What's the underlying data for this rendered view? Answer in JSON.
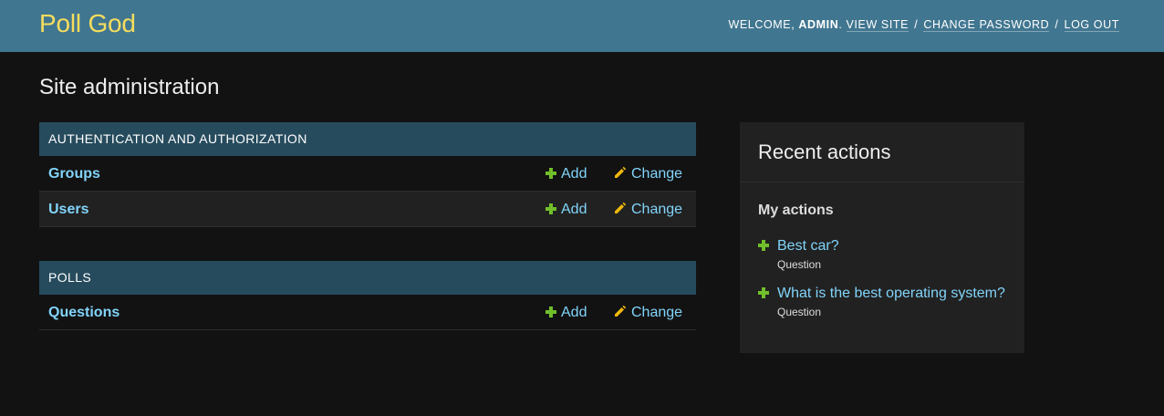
{
  "header": {
    "site_name": "Poll God",
    "welcome_prefix": "Welcome, ",
    "username": "admin",
    "welcome_suffix": ". ",
    "view_site": "View site",
    "change_password": "Change password",
    "log_out": "Log out",
    "separator": "/"
  },
  "page": {
    "title": "Site administration"
  },
  "modules": [
    {
      "caption": "Authentication and Authorization",
      "models": [
        {
          "name": "Groups",
          "add": "Add",
          "change": "Change"
        },
        {
          "name": "Users",
          "add": "Add",
          "change": "Change"
        }
      ]
    },
    {
      "caption": "Polls",
      "models": [
        {
          "name": "Questions",
          "add": "Add",
          "change": "Change"
        }
      ]
    }
  ],
  "recent_actions": {
    "title": "Recent actions",
    "subtitle": "My actions",
    "items": [
      {
        "label": "Best car?",
        "type": "Question",
        "icon": "plus-icon"
      },
      {
        "label": "What is the best operating system?",
        "type": "Question",
        "icon": "plus-icon"
      }
    ]
  },
  "colors": {
    "header_bg": "#417690",
    "brand": "#f5dd5d",
    "module_caption_bg": "#264b5d",
    "link": "#81d4fa",
    "add_icon": "#70bf2b",
    "change_icon": "#efb80b",
    "page_bg": "#121212"
  },
  "icons": {
    "add": "plus-icon",
    "change": "pencil-icon"
  }
}
